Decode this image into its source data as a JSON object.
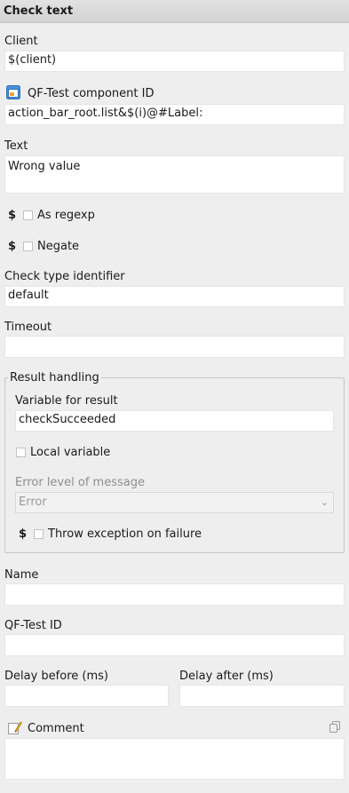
{
  "header": {
    "title": "Check text"
  },
  "client": {
    "label": "Client",
    "value": "$(client)"
  },
  "component": {
    "label": "QF-Test component ID",
    "icon": "component-icon",
    "value": "action_bar_root.list&$(i)@#Label:"
  },
  "text": {
    "label": "Text",
    "value": "Wrong value"
  },
  "regexp": {
    "dollar": "$",
    "label": "As regexp"
  },
  "negate": {
    "dollar": "$",
    "label": "Negate"
  },
  "check_type": {
    "label": "Check type identifier",
    "value": "default"
  },
  "timeout": {
    "label": "Timeout",
    "value": ""
  },
  "result": {
    "title": "Result handling",
    "variable_label": "Variable for result",
    "variable_value": "checkSucceeded",
    "local_label": "Local variable",
    "error_level_label": "Error level of message",
    "error_level_value": "Error",
    "throw_dollar": "$",
    "throw_label": "Throw exception on failure"
  },
  "name": {
    "label": "Name",
    "value": ""
  },
  "qftest_id": {
    "label": "QF-Test ID",
    "value": ""
  },
  "delay_before": {
    "label": "Delay before (ms)",
    "value": ""
  },
  "delay_after": {
    "label": "Delay after (ms)",
    "value": ""
  },
  "comment": {
    "label": "Comment",
    "icon": "comment-edit-icon",
    "copy_icon": "copy-icon",
    "value": ""
  }
}
